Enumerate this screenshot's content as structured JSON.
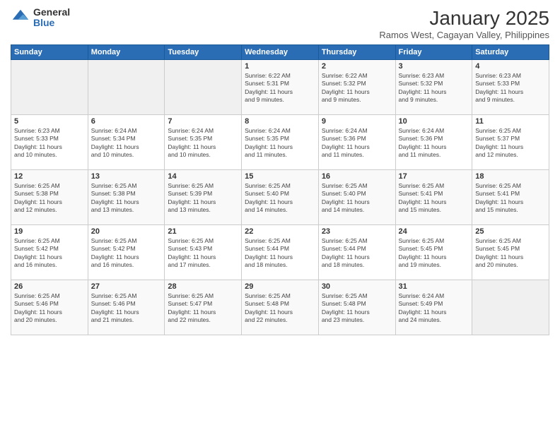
{
  "logo": {
    "general": "General",
    "blue": "Blue"
  },
  "header": {
    "title": "January 2025",
    "subtitle": "Ramos West, Cagayan Valley, Philippines"
  },
  "weekdays": [
    "Sunday",
    "Monday",
    "Tuesday",
    "Wednesday",
    "Thursday",
    "Friday",
    "Saturday"
  ],
  "weeks": [
    [
      {
        "day": "",
        "info": ""
      },
      {
        "day": "",
        "info": ""
      },
      {
        "day": "",
        "info": ""
      },
      {
        "day": "1",
        "info": "Sunrise: 6:22 AM\nSunset: 5:31 PM\nDaylight: 11 hours\nand 9 minutes."
      },
      {
        "day": "2",
        "info": "Sunrise: 6:22 AM\nSunset: 5:32 PM\nDaylight: 11 hours\nand 9 minutes."
      },
      {
        "day": "3",
        "info": "Sunrise: 6:23 AM\nSunset: 5:32 PM\nDaylight: 11 hours\nand 9 minutes."
      },
      {
        "day": "4",
        "info": "Sunrise: 6:23 AM\nSunset: 5:33 PM\nDaylight: 11 hours\nand 9 minutes."
      }
    ],
    [
      {
        "day": "5",
        "info": "Sunrise: 6:23 AM\nSunset: 5:33 PM\nDaylight: 11 hours\nand 10 minutes."
      },
      {
        "day": "6",
        "info": "Sunrise: 6:24 AM\nSunset: 5:34 PM\nDaylight: 11 hours\nand 10 minutes."
      },
      {
        "day": "7",
        "info": "Sunrise: 6:24 AM\nSunset: 5:35 PM\nDaylight: 11 hours\nand 10 minutes."
      },
      {
        "day": "8",
        "info": "Sunrise: 6:24 AM\nSunset: 5:35 PM\nDaylight: 11 hours\nand 11 minutes."
      },
      {
        "day": "9",
        "info": "Sunrise: 6:24 AM\nSunset: 5:36 PM\nDaylight: 11 hours\nand 11 minutes."
      },
      {
        "day": "10",
        "info": "Sunrise: 6:24 AM\nSunset: 5:36 PM\nDaylight: 11 hours\nand 11 minutes."
      },
      {
        "day": "11",
        "info": "Sunrise: 6:25 AM\nSunset: 5:37 PM\nDaylight: 11 hours\nand 12 minutes."
      }
    ],
    [
      {
        "day": "12",
        "info": "Sunrise: 6:25 AM\nSunset: 5:38 PM\nDaylight: 11 hours\nand 12 minutes."
      },
      {
        "day": "13",
        "info": "Sunrise: 6:25 AM\nSunset: 5:38 PM\nDaylight: 11 hours\nand 13 minutes."
      },
      {
        "day": "14",
        "info": "Sunrise: 6:25 AM\nSunset: 5:39 PM\nDaylight: 11 hours\nand 13 minutes."
      },
      {
        "day": "15",
        "info": "Sunrise: 6:25 AM\nSunset: 5:40 PM\nDaylight: 11 hours\nand 14 minutes."
      },
      {
        "day": "16",
        "info": "Sunrise: 6:25 AM\nSunset: 5:40 PM\nDaylight: 11 hours\nand 14 minutes."
      },
      {
        "day": "17",
        "info": "Sunrise: 6:25 AM\nSunset: 5:41 PM\nDaylight: 11 hours\nand 15 minutes."
      },
      {
        "day": "18",
        "info": "Sunrise: 6:25 AM\nSunset: 5:41 PM\nDaylight: 11 hours\nand 15 minutes."
      }
    ],
    [
      {
        "day": "19",
        "info": "Sunrise: 6:25 AM\nSunset: 5:42 PM\nDaylight: 11 hours\nand 16 minutes."
      },
      {
        "day": "20",
        "info": "Sunrise: 6:25 AM\nSunset: 5:42 PM\nDaylight: 11 hours\nand 16 minutes."
      },
      {
        "day": "21",
        "info": "Sunrise: 6:25 AM\nSunset: 5:43 PM\nDaylight: 11 hours\nand 17 minutes."
      },
      {
        "day": "22",
        "info": "Sunrise: 6:25 AM\nSunset: 5:44 PM\nDaylight: 11 hours\nand 18 minutes."
      },
      {
        "day": "23",
        "info": "Sunrise: 6:25 AM\nSunset: 5:44 PM\nDaylight: 11 hours\nand 18 minutes."
      },
      {
        "day": "24",
        "info": "Sunrise: 6:25 AM\nSunset: 5:45 PM\nDaylight: 11 hours\nand 19 minutes."
      },
      {
        "day": "25",
        "info": "Sunrise: 6:25 AM\nSunset: 5:45 PM\nDaylight: 11 hours\nand 20 minutes."
      }
    ],
    [
      {
        "day": "26",
        "info": "Sunrise: 6:25 AM\nSunset: 5:46 PM\nDaylight: 11 hours\nand 20 minutes."
      },
      {
        "day": "27",
        "info": "Sunrise: 6:25 AM\nSunset: 5:46 PM\nDaylight: 11 hours\nand 21 minutes."
      },
      {
        "day": "28",
        "info": "Sunrise: 6:25 AM\nSunset: 5:47 PM\nDaylight: 11 hours\nand 22 minutes."
      },
      {
        "day": "29",
        "info": "Sunrise: 6:25 AM\nSunset: 5:48 PM\nDaylight: 11 hours\nand 22 minutes."
      },
      {
        "day": "30",
        "info": "Sunrise: 6:25 AM\nSunset: 5:48 PM\nDaylight: 11 hours\nand 23 minutes."
      },
      {
        "day": "31",
        "info": "Sunrise: 6:24 AM\nSunset: 5:49 PM\nDaylight: 11 hours\nand 24 minutes."
      },
      {
        "day": "",
        "info": ""
      }
    ]
  ]
}
